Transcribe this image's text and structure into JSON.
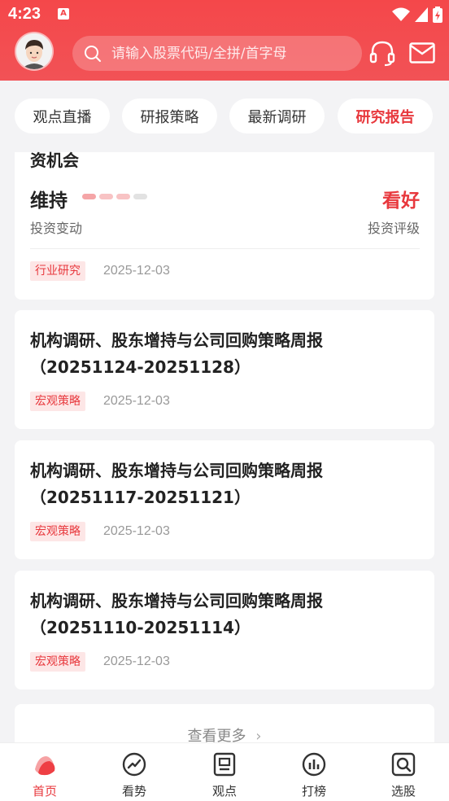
{
  "status": {
    "time": "4:23",
    "app_badge": "A"
  },
  "search": {
    "placeholder": "请输入股票代码/全拼/首字母"
  },
  "tabs": [
    {
      "label": "观点直播"
    },
    {
      "label": "研报策略"
    },
    {
      "label": "最新调研"
    },
    {
      "label": "研究报告"
    }
  ],
  "first_card": {
    "title_tail": "资机会",
    "change_value": "维持",
    "change_caption": "投资变动",
    "rating_value": "看好",
    "rating_caption": "投资评级",
    "tag": "行业研究",
    "date": "2025-12-03",
    "rating_level": 2
  },
  "reports": [
    {
      "title": "机构调研、股东增持与公司回购策略周报（20251124-20251128）",
      "tag": "宏观策略",
      "date": "2025-12-03"
    },
    {
      "title": "机构调研、股东增持与公司回购策略周报（20251117-20251121）",
      "tag": "宏观策略",
      "date": "2025-12-03"
    },
    {
      "title": "机构调研、股东增持与公司回购策略周报（20251110-20251114）",
      "tag": "宏观策略",
      "date": "2025-12-03"
    }
  ],
  "more": {
    "label": "查看更多"
  },
  "nav": [
    {
      "label": "首页"
    },
    {
      "label": "看势"
    },
    {
      "label": "观点"
    },
    {
      "label": "打榜"
    },
    {
      "label": "选股"
    }
  ],
  "colors": {
    "brand": "#f4474a",
    "accent_text": "#e8383d",
    "tag_bg": "#fde6e6"
  }
}
